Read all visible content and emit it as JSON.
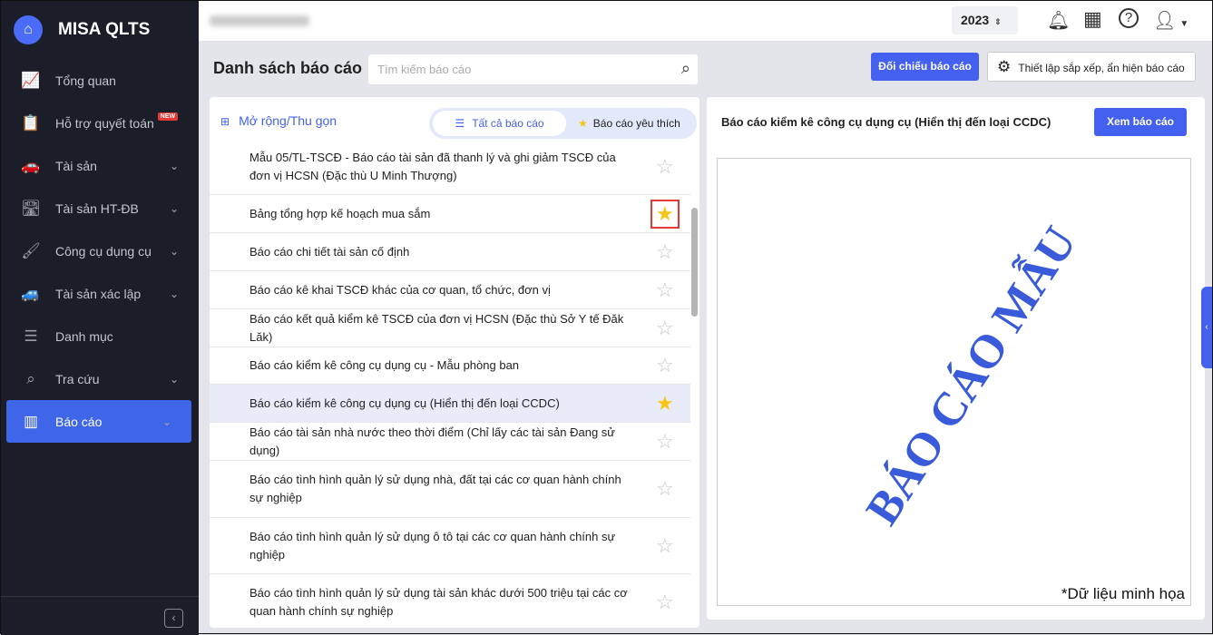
{
  "app": {
    "name": "MISA QLTS"
  },
  "sidebar": {
    "items": [
      {
        "label": "Tổng quan",
        "icon": "monitor-chart-icon",
        "glyph": "📈"
      },
      {
        "label": "Hỗ trợ quyết toán",
        "icon": "clipboard-icon",
        "glyph": "📋",
        "badge": "NEW"
      },
      {
        "label": "Tài sản",
        "icon": "car-icon",
        "glyph": "🚗",
        "chevron": true
      },
      {
        "label": "Tài sản HT-ĐB",
        "icon": "road-icon",
        "glyph": "🛣",
        "chevron": true
      },
      {
        "label": "Công cụ dụng cụ",
        "icon": "roller-icon",
        "glyph": "🖌",
        "chevron": true
      },
      {
        "label": "Tài sản xác lập",
        "icon": "car-icon",
        "glyph": "🚙",
        "chevron": true
      },
      {
        "label": "Danh mục",
        "icon": "list-icon",
        "glyph": "☰"
      },
      {
        "label": "Tra cứu",
        "icon": "search-icon",
        "glyph": "⌕",
        "chevron": true
      },
      {
        "label": "Báo cáo",
        "icon": "bar-chart-icon",
        "glyph": "▥",
        "chevron": true,
        "active": true
      }
    ]
  },
  "header": {
    "year": "2023"
  },
  "page": {
    "title": "Danh sách báo cáo",
    "search_placeholder": "Tìm kiếm báo cáo",
    "compare_button": "Đối chiếu báo cáo",
    "settings_button": "Thiết lập sắp xếp, ẩn hiện báo cáo"
  },
  "list": {
    "expand_label": "Mở rộng/Thu gọn",
    "tab_all": "Tất cả báo cáo",
    "tab_fav": "Báo cáo yêu thích",
    "items": [
      {
        "label": "Mẫu 05/TL-TSCĐ - Báo cáo tài sản đã thanh lý và ghi giảm TSCĐ của đơn vị HCSN (Đặc thù U Minh Thượng)",
        "fav": false,
        "h": 62
      },
      {
        "label": "Bảng tổng hợp kế hoạch mua sắm",
        "fav": true,
        "h": 42,
        "highlight": true
      },
      {
        "label": "Báo cáo chi tiết tài sản cố định",
        "fav": false,
        "h": 42
      },
      {
        "label": "Báo cáo kê khai TSCĐ khác của cơ quan, tổ chức, đơn vị",
        "fav": false,
        "h": 42
      },
      {
        "label": "Báo cáo kết quả kiểm kê TSCĐ của đơn vị HCSN (Đặc thù Sở Y tế Đăk Lăk)",
        "fav": false,
        "h": 42
      },
      {
        "label": "Báo cáo kiểm kê công cụ dụng cụ - Mẫu phòng ban",
        "fav": false,
        "h": 41
      },
      {
        "label": "Báo cáo kiểm kê công cụ dụng cụ (Hiển thị đến loại CCDC)",
        "fav": true,
        "h": 42,
        "selected": true
      },
      {
        "label": "Báo cáo tài sản nhà nước theo thời điểm (Chỉ lấy các tài sản Đang sử dụng)",
        "fav": false,
        "h": 42
      },
      {
        "label": "Báo cáo tình hình quản lý sử dụng nhà, đất tại các cơ quan hành chính sự nghiệp",
        "fav": false,
        "h": 63
      },
      {
        "label": "Báo cáo tình hình quản lý sử dụng ô tô tại các cơ quan hành chính sự nghiệp",
        "fav": false,
        "h": 62
      },
      {
        "label": "Báo cáo tình hình quản lý sử dụng tài sản khác dưới 500 triệu tại các cơ quan hành chính sự nghiệp",
        "fav": false,
        "h": 62
      }
    ]
  },
  "preview": {
    "title": "Báo cáo kiểm kê công cụ dụng cụ (Hiển thị đến loại CCDC)",
    "view_button": "Xem báo cáo",
    "watermark": "BÁO CÁO MẪU",
    "note": "*Dữ liệu minh họa"
  },
  "colors": {
    "accent": "#4361ee",
    "sidebar": "#1b1d29",
    "star": "#f5c518"
  }
}
